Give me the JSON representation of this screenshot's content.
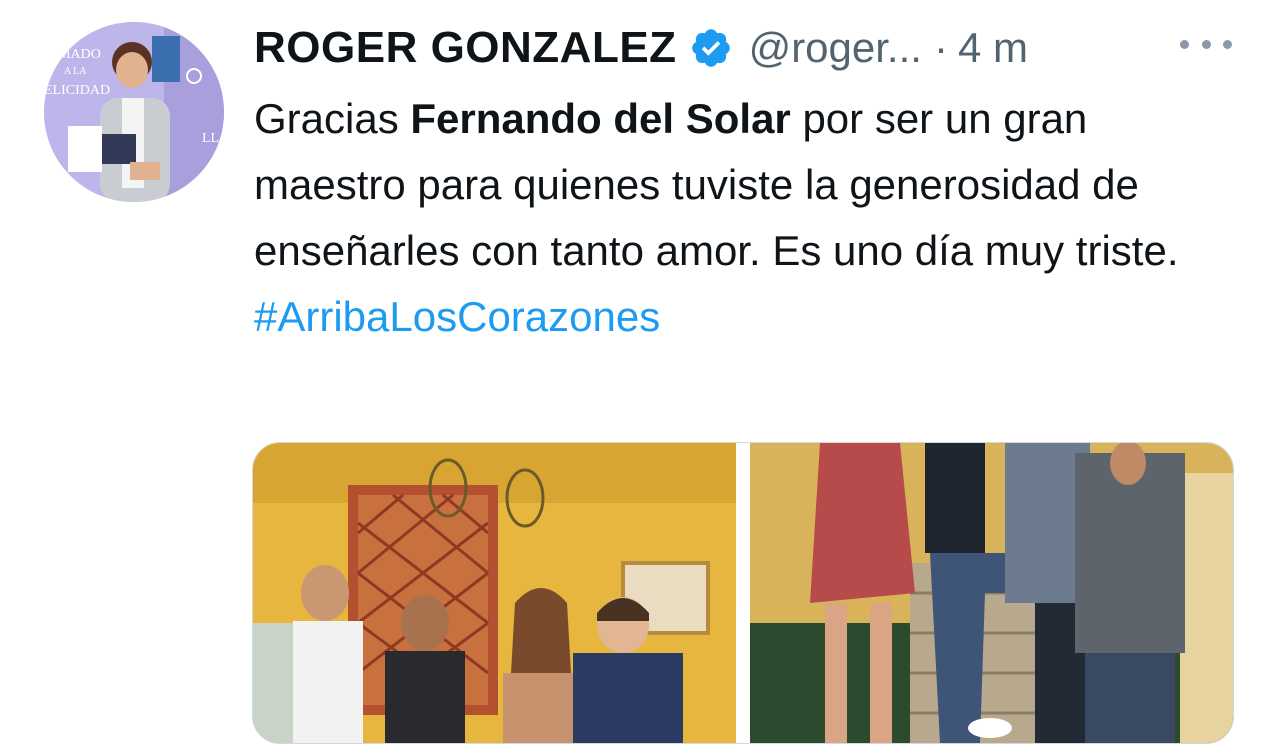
{
  "author": {
    "display_name": "ROGER GONZALEZ",
    "handle": "@roger...",
    "separator": "·",
    "timestamp": "4 m",
    "verified": true,
    "avatar_text": [
      "AMADO",
      "A LA",
      "ELICIDAD",
      "LLA"
    ]
  },
  "tweet": {
    "text_before": "Gracias ",
    "mention_bold": "Fernando del Solar",
    "text_after": " por ser un gran maestro para quienes tuviste la generosidad de enseñarles con tanto amor. Es uno día muy triste.",
    "hashtag": "#ArribaLosCorazones"
  },
  "media": {
    "count": 2,
    "photos": [
      "group-photo-tv-set",
      "group-photo-standing"
    ]
  },
  "colors": {
    "text": "#0f1419",
    "secondary": "#536471",
    "link": "#1d9bf0",
    "verified": "#1d9bf0"
  },
  "icons": {
    "verified": "verified-badge-icon",
    "more": "more-options-icon"
  }
}
